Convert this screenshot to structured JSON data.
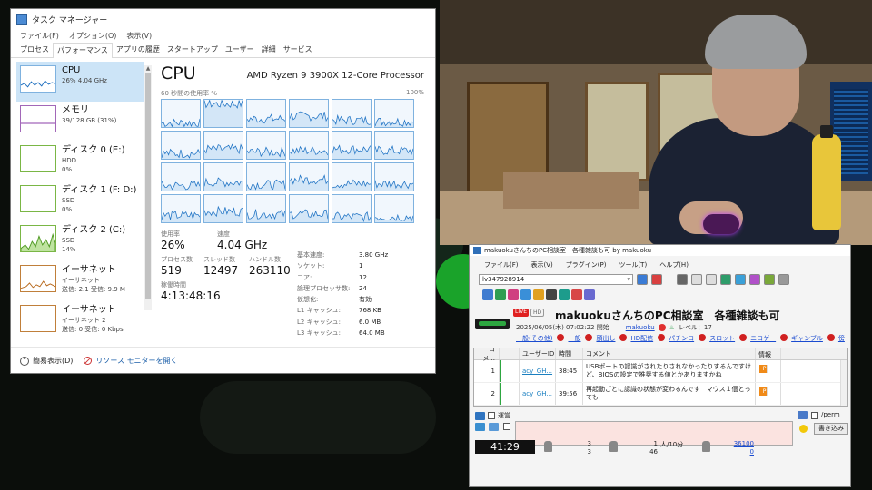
{
  "task_manager": {
    "title": "タスク マネージャー",
    "menu": [
      "ファイル(F)",
      "オプション(O)",
      "表示(V)"
    ],
    "tabs": [
      "プロセス",
      "パフォーマンス",
      "アプリの履歴",
      "スタートアップ",
      "ユーザー",
      "詳細",
      "サービス"
    ],
    "active_tab": "パフォーマンス",
    "sidebar": [
      {
        "name": "CPU",
        "sub1": "26%  4.04 GHz",
        "sub2": "",
        "kind": "cpu"
      },
      {
        "name": "メモリ",
        "sub1": "39/128 GB (31%)",
        "sub2": "",
        "kind": "mem"
      },
      {
        "name": "ディスク 0 (E:)",
        "sub1": "HDD",
        "sub2": "0%",
        "kind": "disk"
      },
      {
        "name": "ディスク 1 (F: D:)",
        "sub1": "SSD",
        "sub2": "0%",
        "kind": "disk"
      },
      {
        "name": "ディスク 2 (C:)",
        "sub1": "SSD",
        "sub2": "14%",
        "kind": "disk"
      },
      {
        "name": "イーサネット",
        "sub1": "イーサネット",
        "sub2": "送信: 2.1 受信: 9.9 M",
        "kind": "net"
      },
      {
        "name": "イーサネット",
        "sub1": "イーサネット 2",
        "sub2": "送信: 0 受信: 0 Kbps",
        "kind": "net"
      }
    ],
    "cpu": {
      "heading": "CPU",
      "processor": "AMD Ryzen 9 3900X 12-Core Processor",
      "graph_label_left": "60 秒間の使用率 %",
      "graph_label_right": "100%",
      "stats": {
        "usage_label": "使用率",
        "usage": "26%",
        "speed_label": "速度",
        "speed": "4.04 GHz",
        "processes_label": "プロセス数",
        "processes": "519",
        "threads_label": "スレッド数",
        "threads": "12497",
        "handles_label": "ハンドル数",
        "handles": "263110",
        "uptime_label": "稼働時間",
        "uptime": "4:13:48:16"
      },
      "info": [
        {
          "k": "基本速度:",
          "v": "3.80 GHz"
        },
        {
          "k": "ソケット:",
          "v": "1"
        },
        {
          "k": "コア:",
          "v": "12"
        },
        {
          "k": "論理プロセッサ数:",
          "v": "24"
        },
        {
          "k": "仮想化:",
          "v": "有効"
        },
        {
          "k": "L1 キャッシュ:",
          "v": "768 KB"
        },
        {
          "k": "L2 キャッシュ:",
          "v": "6.0 MB"
        },
        {
          "k": "L3 キャッシュ:",
          "v": "64.0 MB"
        }
      ]
    },
    "footer": {
      "fewer_details": "簡易表示(D)",
      "resource_monitor": "リソース モニターを開く"
    }
  },
  "comment_viewer": {
    "title": "makuokuさんちのPC相談室　各種雑談も可 by makuoku",
    "menu": [
      "ファイル(F)",
      "表示(V)",
      "プラグイン(P)",
      "ツール(T)",
      "ヘルプ(H)"
    ],
    "live_id": "lv347928914",
    "live_badge": "LIVE",
    "hd_badge": "HD",
    "room_title": "makuokuさんちのPC相談室　各種雑談も可",
    "start": "2025/06/05(木) 07:02:22 開始",
    "owner": "makuoku",
    "level": "レベル：17",
    "tags": [
      "一般(その他)",
      "一般",
      "顔出し",
      "HD配信",
      "パチンコ",
      "スロット",
      "ニコゲー",
      "ギャンブル",
      "傍"
    ],
    "columns": [
      "コメ...",
      "",
      "ユーザーID",
      "時間",
      "コメント",
      "情報"
    ],
    "comments": [
      {
        "no": "1",
        "uid": "acy_GH...",
        "time": "38:45",
        "text": "USBポートの認識がされたりされなかったりするんですけど、BIOSの設定で推奨する値とかありますかね"
      },
      {
        "no": "2",
        "uid": "acy_GH...",
        "time": "39:56",
        "text": "再起動ごとに認識の状態が変わるんです　マウス１個とっても"
      }
    ],
    "input": {
      "label_regular": "運営",
      "label_perm": "/perm",
      "post_button": "書き込み"
    },
    "status": {
      "elapsed": "41:29",
      "c1a": "3",
      "c1b": "3",
      "c2a": "1",
      "c2b": "46",
      "c2c": "人/10分",
      "link1": "36100",
      "link2": "0"
    }
  },
  "cpu_core_usage": [
    [
      0.15,
      0.85,
      0.3,
      0.4,
      0.25,
      0.2
    ],
    [
      0.2,
      0.35,
      0.25,
      0.3,
      0.35,
      0.3
    ],
    [
      0.18,
      0.3,
      0.22,
      0.4,
      0.25,
      0.25
    ],
    [
      0.25,
      0.4,
      0.3,
      0.3,
      0.2,
      0.2
    ]
  ]
}
